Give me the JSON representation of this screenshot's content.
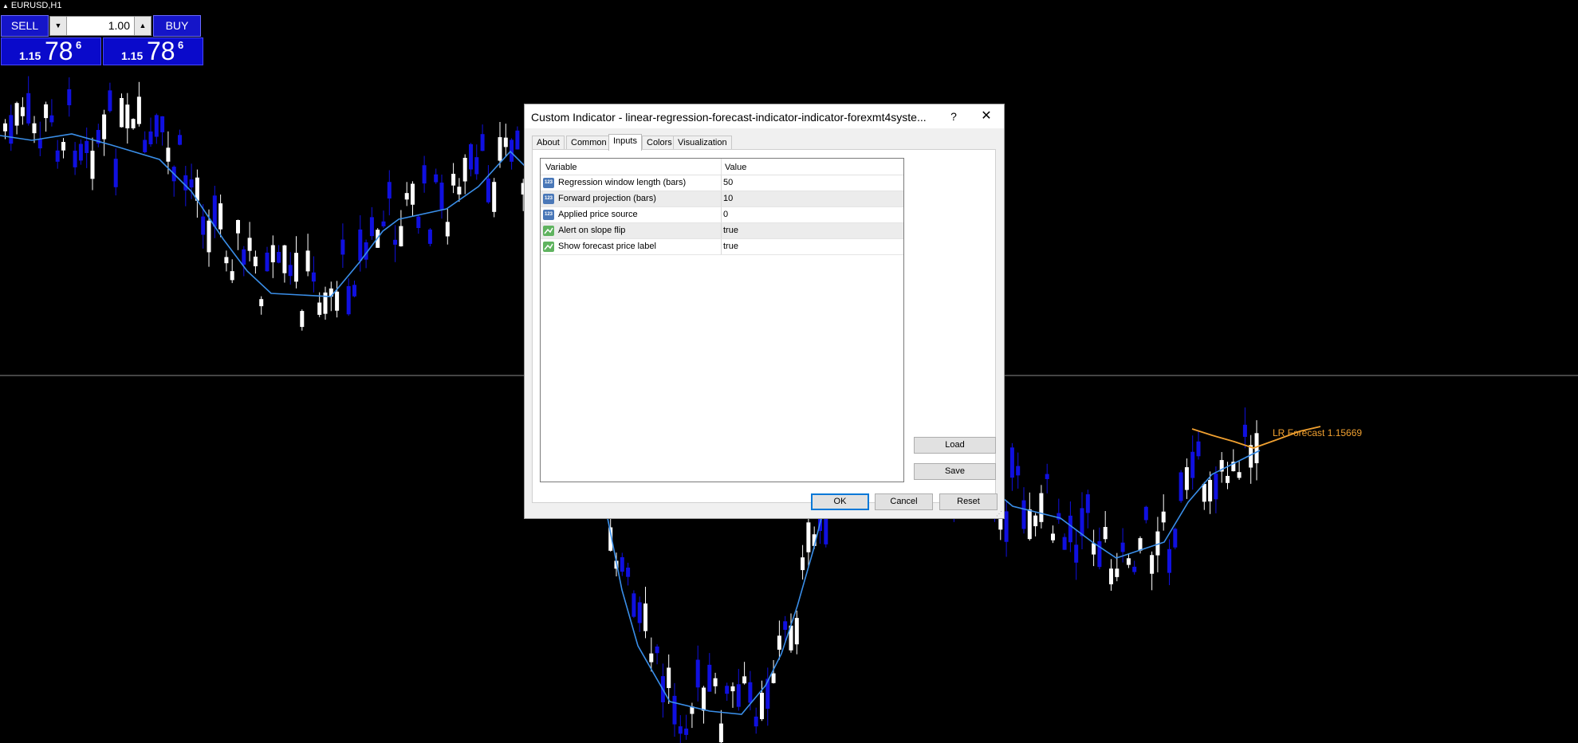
{
  "chart": {
    "symbol": "EURUSD,H1",
    "forecast_label": "LR Forecast 1.15669",
    "colors": {
      "bull": "#ffffff",
      "bear": "#1010e0",
      "ma": "#3a8ee8",
      "forecast": "#f0a030",
      "hline": "#8a8a8a"
    }
  },
  "trade_panel": {
    "sell_label": "SELL",
    "buy_label": "BUY",
    "lot_value": "1.00",
    "bid": {
      "big": "1.15",
      "pips": "78",
      "frac": "6"
    },
    "ask": {
      "big": "1.15",
      "pips": "78",
      "frac": "6"
    }
  },
  "dialog": {
    "title": "Custom Indicator - linear-regression-forecast-indicator-indicator-forexmt4syste...",
    "help": "?",
    "close": "✕",
    "tabs": [
      "About",
      "Common",
      "Inputs",
      "Colors",
      "Visualization"
    ],
    "active_tab": "Inputs",
    "grid": {
      "header_variable": "Variable",
      "header_value": "Value",
      "rows": [
        {
          "icon": "numeric-param-icon",
          "variable": "Regression window length (bars)",
          "value": "50"
        },
        {
          "icon": "numeric-param-icon",
          "variable": "Forward projection (bars)",
          "value": "10"
        },
        {
          "icon": "numeric-param-icon",
          "variable": "Applied price source",
          "value": "0"
        },
        {
          "icon": "boolean-param-icon",
          "variable": "Alert on slope flip",
          "value": "true"
        },
        {
          "icon": "boolean-param-icon",
          "variable": "Show forecast price label",
          "value": "true"
        }
      ]
    },
    "load_label": "Load",
    "save_label": "Save",
    "ok_label": "OK",
    "cancel_label": "Cancel",
    "reset_label": "Reset"
  }
}
